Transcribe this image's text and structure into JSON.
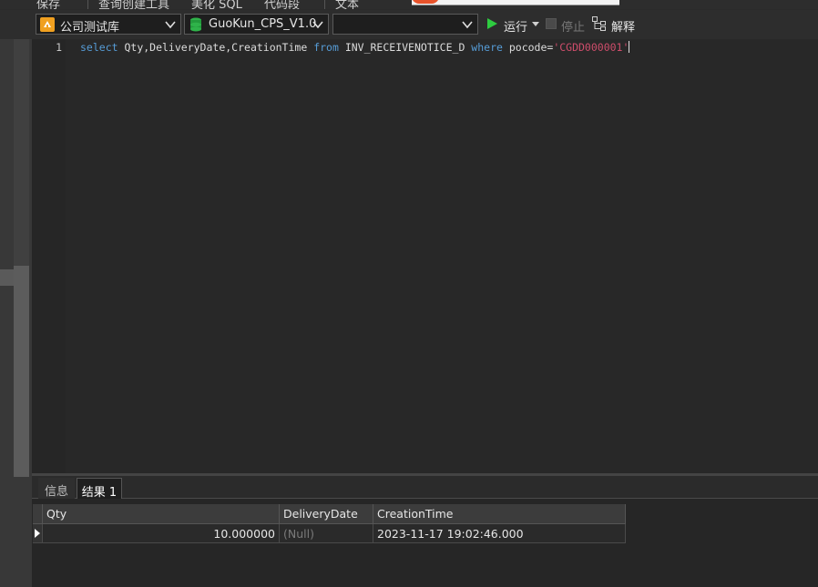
{
  "top_toolbar": {
    "item_1": "保存",
    "item_2": "查询创建工具",
    "item_3": "美化 SQL",
    "item_4": "代码段",
    "item_5": "文本"
  },
  "toolbar": {
    "connection": "公司测试库",
    "database": "GuoKun_CPS_V1.0",
    "schema": "",
    "run_label": "运行",
    "stop_label": "停止",
    "explain_label": "解释"
  },
  "editor": {
    "line_number": "1",
    "code": {
      "kw_select": "select",
      "columns": " Qty,DeliveryDate,CreationTime ",
      "kw_from": "from",
      "table": " INV_RECEIVENOTICE_D ",
      "kw_where": "where",
      "condition": " pocode=",
      "string": "'CGDD000001'"
    }
  },
  "result_tabs": {
    "info": "信息",
    "result": "结果 1"
  },
  "grid": {
    "columns": [
      "Qty",
      "DeliveryDate",
      "CreationTime"
    ],
    "rows": [
      {
        "qty": "10.000000",
        "delivery_date": "(Null)",
        "creation_time": "2023-11-17 19:02:46.000"
      }
    ]
  },
  "colors": {
    "keyword": "#569cd6",
    "string": "#ce4d6b",
    "run_icon": "#2ecc40",
    "null_text": "#7a7a7a"
  }
}
